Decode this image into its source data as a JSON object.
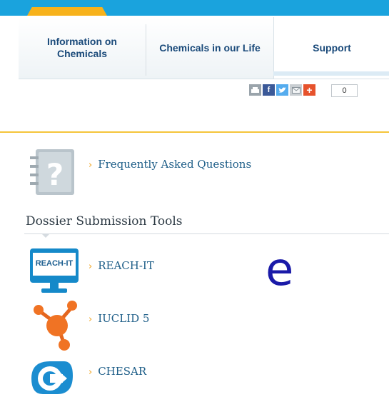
{
  "nav": {
    "items": [
      {
        "label": "Information on Chemicals"
      },
      {
        "label": "Chemicals in our Life"
      },
      {
        "label": "Support"
      }
    ]
  },
  "share": {
    "count": "0",
    "icons": [
      "print-icon",
      "facebook-icon",
      "twitter-icon",
      "email-icon",
      "add-icon"
    ]
  },
  "faq": {
    "label": "Frequently Asked Questions"
  },
  "section": {
    "title": "Dossier Submission Tools"
  },
  "tools": [
    {
      "label": "REACH-IT",
      "badge": "REACH-IT"
    },
    {
      "label": "IUCLID 5"
    },
    {
      "label": "CHESAR"
    }
  ],
  "overlay": {
    "letter": "e"
  },
  "colors": {
    "accent_blue": "#1aa3dd",
    "accent_gold": "#f7b21b",
    "link": "#1e5e88",
    "nav_text": "#1a4a7a",
    "overlay": "#1a1aa8"
  }
}
